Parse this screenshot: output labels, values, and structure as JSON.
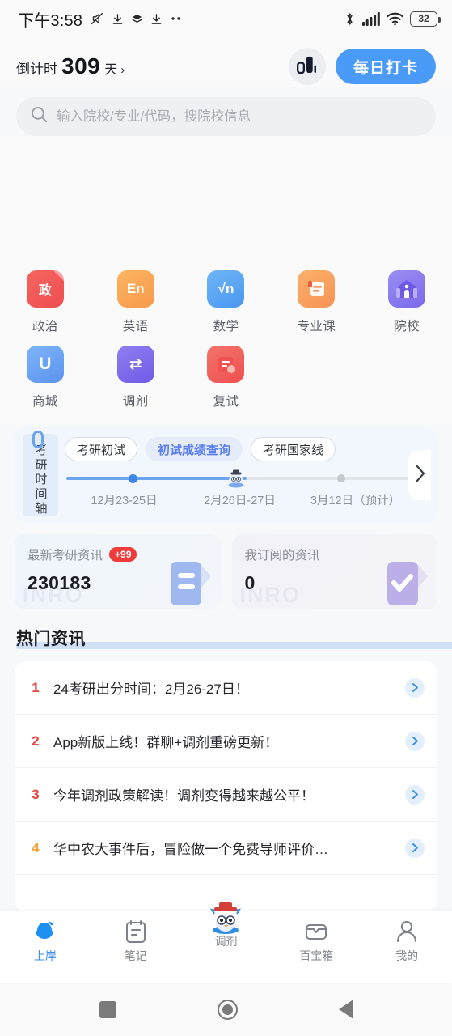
{
  "status_bar": {
    "time": "下午3:58",
    "battery_level": "32",
    "icons": [
      "mute-icon",
      "download-icon",
      "layers-icon",
      "download-icon",
      "more-dots-icon",
      "bluetooth-icon",
      "signal-icon",
      "wifi-icon",
      "battery-icon"
    ]
  },
  "header": {
    "countdown_label": "倒计时",
    "countdown_days": "309",
    "countdown_unit": "天",
    "countdown_arrow": "›",
    "stats_icon": "bar-chart-icon",
    "checkin_label": "每日打卡",
    "accent_color": "#4a9bf7"
  },
  "search": {
    "placeholder": "输入院校/专业/代码，搜院校信息",
    "value": "",
    "icon": "search-icon"
  },
  "grid": {
    "rows": [
      [
        {
          "label": "政治",
          "glyph": "政",
          "icon": "politics-book-icon",
          "cls": "t-politics",
          "color": "#ef4e52"
        },
        {
          "label": "英语",
          "glyph": "En",
          "icon": "english-book-icon",
          "cls": "t-english",
          "color": "#f79a4b"
        },
        {
          "label": "数学",
          "glyph": "√n",
          "icon": "math-icon",
          "cls": "t-math",
          "color": "#4a97f0"
        },
        {
          "label": "专业课",
          "glyph": "",
          "icon": "scroll-icon",
          "cls": "t-major",
          "color": "#f79455"
        },
        {
          "label": "院校",
          "glyph": "",
          "icon": "school-building-icon",
          "cls": "t-school",
          "color": "#7b69ea"
        }
      ],
      [
        {
          "label": "商城",
          "glyph": "U",
          "icon": "mall-icon",
          "cls": "t-mall",
          "color": "#5a93ef"
        },
        {
          "label": "调剂",
          "glyph": "⇄",
          "icon": "transfer-icon",
          "cls": "t-transfer",
          "color": "#6f5ae6"
        },
        {
          "label": "复试",
          "glyph": "",
          "icon": "retest-icon",
          "cls": "t-retest",
          "color": "#ef5050"
        }
      ]
    ]
  },
  "timeline": {
    "tab_label": "考研时间轴",
    "clip_icon": "paperclip-icon",
    "next_icon": "chevron-right-icon",
    "mascot_icon": "owl-mascot-icon",
    "stages": [
      {
        "chip": "考研初试",
        "date": "12月23-25日",
        "active": false
      },
      {
        "chip": "初试成绩查询",
        "date": "2月26日-27日",
        "active": true
      },
      {
        "chip": "考研国家线",
        "date": "3月12日（预计）",
        "active": false
      }
    ],
    "progress_percent": 52
  },
  "info_cards": [
    {
      "title": "最新考研资讯",
      "badge": "+99",
      "value": "230183",
      "watermark": "INRO",
      "glyph_icon": "document-lines-icon",
      "theme": "blue"
    },
    {
      "title": "我订阅的资讯",
      "badge": "",
      "value": "0",
      "watermark": "INRO",
      "glyph_icon": "check-document-icon",
      "theme": "purple"
    }
  ],
  "hot_news": {
    "section_title": "热门资讯",
    "items": [
      {
        "rank": "1",
        "text": "24考研出分时间：2月26-27日！",
        "arrow_icon": "chevron-right-icon"
      },
      {
        "rank": "2",
        "text": "App新版上线！群聊+调剂重磅更新！",
        "arrow_icon": "chevron-right-icon"
      },
      {
        "rank": "3",
        "text": "今年调剂政策解读！调剂变得越来越公平！",
        "arrow_icon": "chevron-right-icon"
      },
      {
        "rank": "4",
        "text": "华中农大事件后，冒险做一个免费导师评价…",
        "arrow_icon": "chevron-right-icon"
      }
    ]
  },
  "tabbar": {
    "items": [
      {
        "label": "上岸",
        "icon": "graduation-cap-icon",
        "active": true
      },
      {
        "label": "笔记",
        "icon": "notebook-icon",
        "active": false
      },
      {
        "label": "调剂",
        "icon": "owl-mascot-icon",
        "active": false
      },
      {
        "label": "百宝箱",
        "icon": "treasure-box-icon",
        "active": false
      },
      {
        "label": "我的",
        "icon": "person-icon",
        "active": false
      }
    ],
    "active_color": "#3d8ee8"
  },
  "android_nav": {
    "recents_icon": "square-icon",
    "home_icon": "circle-icon",
    "back_icon": "triangle-back-icon"
  }
}
